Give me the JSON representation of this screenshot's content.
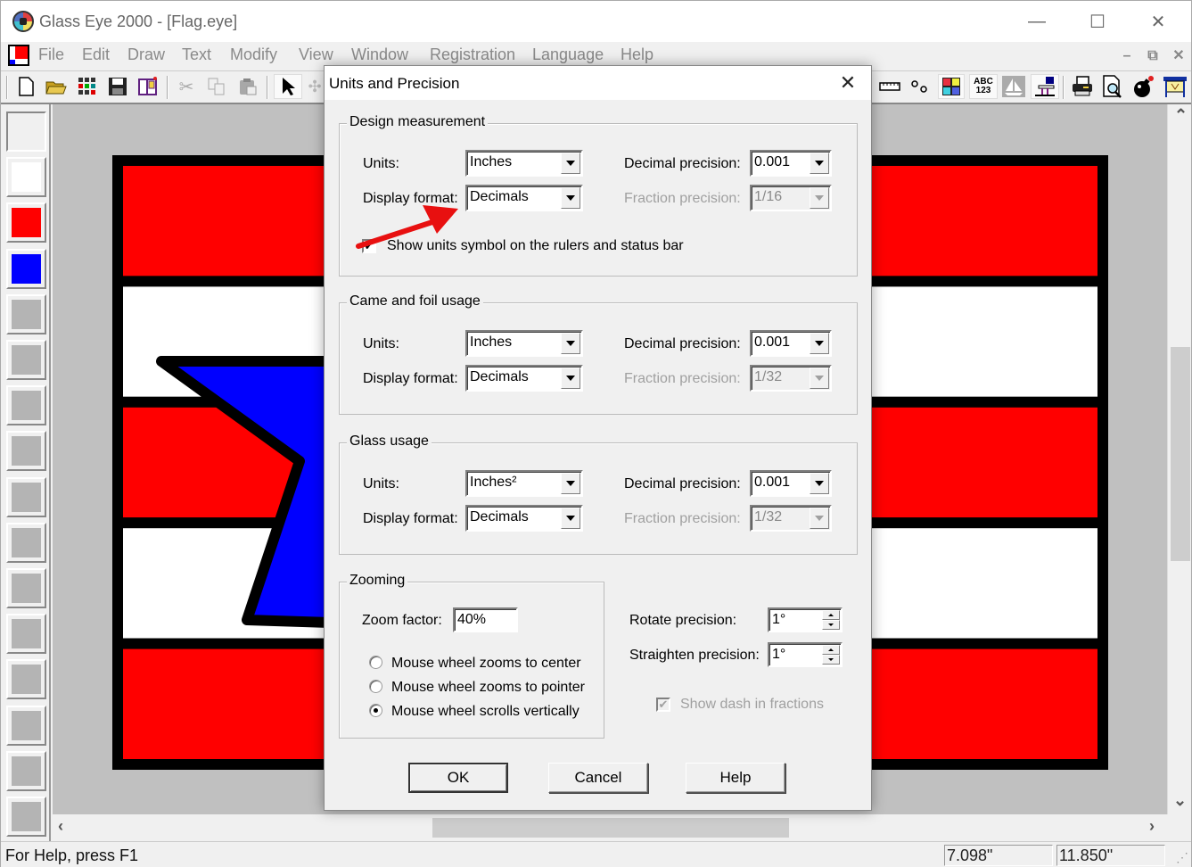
{
  "window": {
    "title": "Glass Eye 2000 - [Flag.eye]",
    "controls": {
      "minimize": "—",
      "maximize": "☐",
      "close": "✕"
    }
  },
  "menubar": {
    "items": [
      "File",
      "Edit",
      "Draw",
      "Text",
      "Modify",
      "View",
      "Window",
      "Registration",
      "Language",
      "Help"
    ],
    "mdi_controls": {
      "minimize": "–",
      "restore": "⧉",
      "close": "✕"
    }
  },
  "toolbar": {
    "left_icons": [
      "new-file",
      "open-folder",
      "grid-palette",
      "save",
      "book",
      "cut",
      "copy",
      "paste",
      "pointer",
      "puzzle"
    ],
    "right_icons": [
      "ruler",
      "nodes",
      "color-grid",
      "abc-123",
      "sailboat",
      "flag-stand",
      "printer",
      "print-preview",
      "bomb",
      "plotter"
    ],
    "abc_label": "ABC\n123"
  },
  "palette": {
    "swatches": [
      {
        "name": "empty",
        "color": "#f0f0f0"
      },
      {
        "name": "white",
        "color": "#ffffff"
      },
      {
        "name": "red",
        "color": "#ff0000"
      },
      {
        "name": "blue",
        "color": "#0000ff"
      },
      {
        "name": "gray",
        "color": "#b4b4b4"
      },
      {
        "name": "gray",
        "color": "#b4b4b4"
      },
      {
        "name": "gray",
        "color": "#b4b4b4"
      },
      {
        "name": "gray",
        "color": "#b4b4b4"
      },
      {
        "name": "gray",
        "color": "#b4b4b4"
      },
      {
        "name": "gray",
        "color": "#b4b4b4"
      },
      {
        "name": "gray",
        "color": "#b4b4b4"
      },
      {
        "name": "gray",
        "color": "#b4b4b4"
      },
      {
        "name": "gray",
        "color": "#b4b4b4"
      },
      {
        "name": "gray",
        "color": "#b4b4b4"
      },
      {
        "name": "gray",
        "color": "#b4b4b4"
      },
      {
        "name": "gray",
        "color": "#b4b4b4"
      }
    ]
  },
  "canvas": {
    "stripe_colors": [
      "#ff0000",
      "#ffffff",
      "#ff0000",
      "#ffffff",
      "#ff0000"
    ],
    "star_color": "#0000ff",
    "lead_color": "#000000",
    "background": "#c0c0c0"
  },
  "dialog": {
    "title": "Units and Precision",
    "close": "✕",
    "design": {
      "label": "Design measurement",
      "units_label": "Units:",
      "units_value": "Inches",
      "format_label": "Display format:",
      "format_value": "Decimals",
      "decimal_label": "Decimal precision:",
      "decimal_value": "0.001",
      "fraction_label": "Fraction precision:",
      "fraction_value": "1/16",
      "show_units_label": "Show units symbol on the rulers and status bar",
      "show_units_checked": true
    },
    "came": {
      "label": "Came and foil usage",
      "units_label": "Units:",
      "units_value": "Inches",
      "format_label": "Display format:",
      "format_value": "Decimals",
      "decimal_label": "Decimal precision:",
      "decimal_value": "0.001",
      "fraction_label": "Fraction precision:",
      "fraction_value": "1/32"
    },
    "glass": {
      "label": "Glass usage",
      "units_label": "Units:",
      "units_value": "Inches²",
      "format_label": "Display format:",
      "format_value": "Decimals",
      "decimal_label": "Decimal precision:",
      "decimal_value": "0.001",
      "fraction_label": "Fraction precision:",
      "fraction_value": "1/32"
    },
    "zooming": {
      "label": "Zooming",
      "zoom_factor_label": "Zoom factor:",
      "zoom_factor_value": "40%",
      "radio_options": [
        {
          "label": "Mouse wheel zooms to center",
          "checked": false
        },
        {
          "label": "Mouse wheel zooms to pointer",
          "checked": false
        },
        {
          "label": "Mouse wheel scrolls vertically",
          "checked": true
        }
      ]
    },
    "rotate_label": "Rotate precision:",
    "rotate_value": "1°",
    "straighten_label": "Straighten precision:",
    "straighten_value": "1°",
    "show_dash_label": "Show dash in fractions",
    "show_dash_checked": true,
    "buttons": {
      "ok": "OK",
      "cancel": "Cancel",
      "help": "Help"
    },
    "annotation_arrow_color": "#e81010"
  },
  "statusbar": {
    "help_text": "For Help, press F1",
    "x_value": "7.098\"",
    "y_value": "11.850\""
  }
}
